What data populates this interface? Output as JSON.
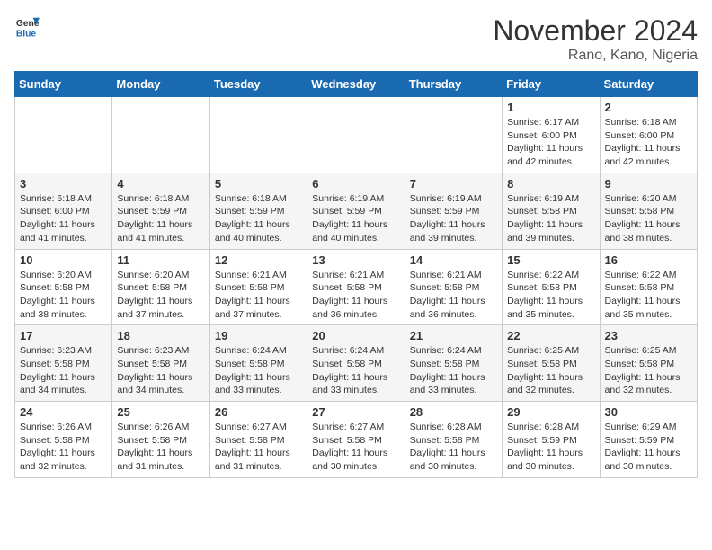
{
  "header": {
    "logo_line1": "General",
    "logo_line2": "Blue",
    "month_title": "November 2024",
    "location": "Rano, Kano, Nigeria"
  },
  "days_of_week": [
    "Sunday",
    "Monday",
    "Tuesday",
    "Wednesday",
    "Thursday",
    "Friday",
    "Saturday"
  ],
  "weeks": [
    [
      {
        "day": "",
        "info": ""
      },
      {
        "day": "",
        "info": ""
      },
      {
        "day": "",
        "info": ""
      },
      {
        "day": "",
        "info": ""
      },
      {
        "day": "",
        "info": ""
      },
      {
        "day": "1",
        "info": "Sunrise: 6:17 AM\nSunset: 6:00 PM\nDaylight: 11 hours\nand 42 minutes."
      },
      {
        "day": "2",
        "info": "Sunrise: 6:18 AM\nSunset: 6:00 PM\nDaylight: 11 hours\nand 42 minutes."
      }
    ],
    [
      {
        "day": "3",
        "info": "Sunrise: 6:18 AM\nSunset: 6:00 PM\nDaylight: 11 hours\nand 41 minutes."
      },
      {
        "day": "4",
        "info": "Sunrise: 6:18 AM\nSunset: 5:59 PM\nDaylight: 11 hours\nand 41 minutes."
      },
      {
        "day": "5",
        "info": "Sunrise: 6:18 AM\nSunset: 5:59 PM\nDaylight: 11 hours\nand 40 minutes."
      },
      {
        "day": "6",
        "info": "Sunrise: 6:19 AM\nSunset: 5:59 PM\nDaylight: 11 hours\nand 40 minutes."
      },
      {
        "day": "7",
        "info": "Sunrise: 6:19 AM\nSunset: 5:59 PM\nDaylight: 11 hours\nand 39 minutes."
      },
      {
        "day": "8",
        "info": "Sunrise: 6:19 AM\nSunset: 5:58 PM\nDaylight: 11 hours\nand 39 minutes."
      },
      {
        "day": "9",
        "info": "Sunrise: 6:20 AM\nSunset: 5:58 PM\nDaylight: 11 hours\nand 38 minutes."
      }
    ],
    [
      {
        "day": "10",
        "info": "Sunrise: 6:20 AM\nSunset: 5:58 PM\nDaylight: 11 hours\nand 38 minutes."
      },
      {
        "day": "11",
        "info": "Sunrise: 6:20 AM\nSunset: 5:58 PM\nDaylight: 11 hours\nand 37 minutes."
      },
      {
        "day": "12",
        "info": "Sunrise: 6:21 AM\nSunset: 5:58 PM\nDaylight: 11 hours\nand 37 minutes."
      },
      {
        "day": "13",
        "info": "Sunrise: 6:21 AM\nSunset: 5:58 PM\nDaylight: 11 hours\nand 36 minutes."
      },
      {
        "day": "14",
        "info": "Sunrise: 6:21 AM\nSunset: 5:58 PM\nDaylight: 11 hours\nand 36 minutes."
      },
      {
        "day": "15",
        "info": "Sunrise: 6:22 AM\nSunset: 5:58 PM\nDaylight: 11 hours\nand 35 minutes."
      },
      {
        "day": "16",
        "info": "Sunrise: 6:22 AM\nSunset: 5:58 PM\nDaylight: 11 hours\nand 35 minutes."
      }
    ],
    [
      {
        "day": "17",
        "info": "Sunrise: 6:23 AM\nSunset: 5:58 PM\nDaylight: 11 hours\nand 34 minutes."
      },
      {
        "day": "18",
        "info": "Sunrise: 6:23 AM\nSunset: 5:58 PM\nDaylight: 11 hours\nand 34 minutes."
      },
      {
        "day": "19",
        "info": "Sunrise: 6:24 AM\nSunset: 5:58 PM\nDaylight: 11 hours\nand 33 minutes."
      },
      {
        "day": "20",
        "info": "Sunrise: 6:24 AM\nSunset: 5:58 PM\nDaylight: 11 hours\nand 33 minutes."
      },
      {
        "day": "21",
        "info": "Sunrise: 6:24 AM\nSunset: 5:58 PM\nDaylight: 11 hours\nand 33 minutes."
      },
      {
        "day": "22",
        "info": "Sunrise: 6:25 AM\nSunset: 5:58 PM\nDaylight: 11 hours\nand 32 minutes."
      },
      {
        "day": "23",
        "info": "Sunrise: 6:25 AM\nSunset: 5:58 PM\nDaylight: 11 hours\nand 32 minutes."
      }
    ],
    [
      {
        "day": "24",
        "info": "Sunrise: 6:26 AM\nSunset: 5:58 PM\nDaylight: 11 hours\nand 32 minutes."
      },
      {
        "day": "25",
        "info": "Sunrise: 6:26 AM\nSunset: 5:58 PM\nDaylight: 11 hours\nand 31 minutes."
      },
      {
        "day": "26",
        "info": "Sunrise: 6:27 AM\nSunset: 5:58 PM\nDaylight: 11 hours\nand 31 minutes."
      },
      {
        "day": "27",
        "info": "Sunrise: 6:27 AM\nSunset: 5:58 PM\nDaylight: 11 hours\nand 30 minutes."
      },
      {
        "day": "28",
        "info": "Sunrise: 6:28 AM\nSunset: 5:58 PM\nDaylight: 11 hours\nand 30 minutes."
      },
      {
        "day": "29",
        "info": "Sunrise: 6:28 AM\nSunset: 5:59 PM\nDaylight: 11 hours\nand 30 minutes."
      },
      {
        "day": "30",
        "info": "Sunrise: 6:29 AM\nSunset: 5:59 PM\nDaylight: 11 hours\nand 30 minutes."
      }
    ]
  ]
}
